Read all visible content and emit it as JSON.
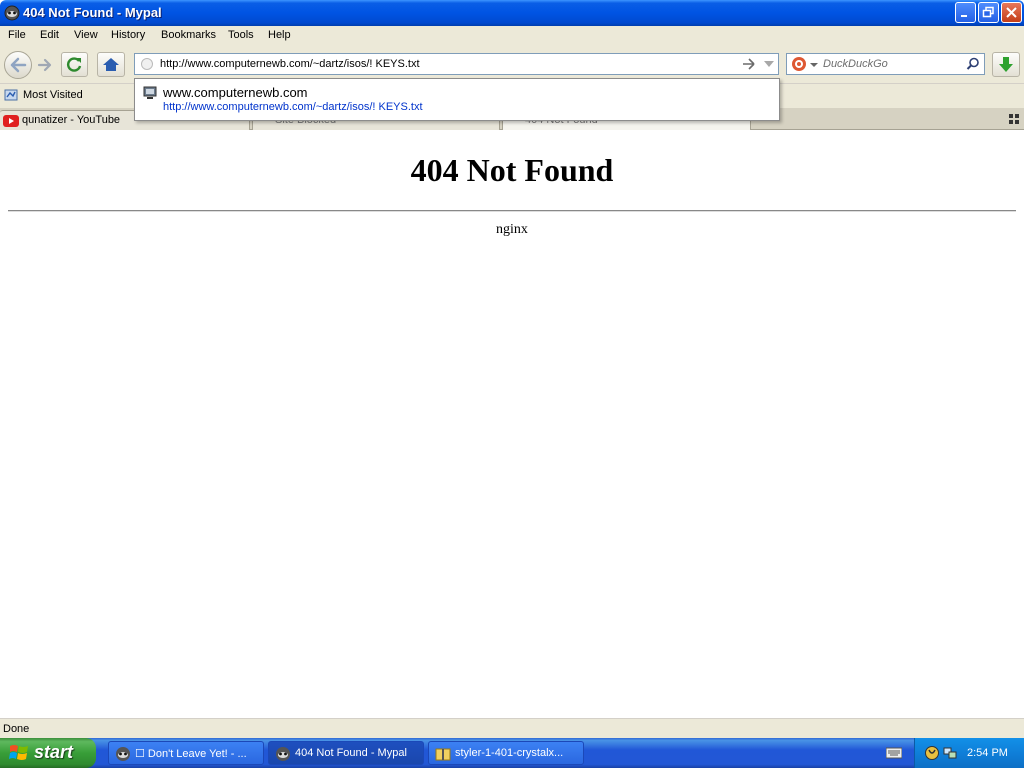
{
  "window": {
    "title": "404 Not Found - Mypal"
  },
  "menu": [
    "File",
    "Edit",
    "View",
    "History",
    "Bookmarks",
    "Tools",
    "Help"
  ],
  "navbar": {
    "url": "http://www.computernewb.com/~dartz/isos/! KEYS.txt",
    "search_placeholder": "DuckDuckGo"
  },
  "bookmarks": {
    "most_visited": "Most Visited"
  },
  "tabs": [
    {
      "label": "qunatizer - YouTube",
      "active": false
    },
    {
      "label": "Site Blocked",
      "active": false
    },
    {
      "label": "404 Not Found",
      "active": true
    }
  ],
  "autocomplete": {
    "title": "www.computernewb.com",
    "url": "http://www.computernewb.com/~dartz/isos/! KEYS.txt"
  },
  "page": {
    "heading": "404 Not Found",
    "server": "nginx"
  },
  "status": {
    "text": "Done"
  },
  "taskbar": {
    "start": "start",
    "items": [
      {
        "label": "☐ Don't Leave Yet! - ...",
        "active": false
      },
      {
        "label": "404 Not Found - Mypal",
        "active": true
      },
      {
        "label": "styler-1-401-crystalx...",
        "active": false
      }
    ],
    "clock": "2:54 PM"
  },
  "colors": {
    "titlebar": "#0054e3",
    "chrome": "#ece9d8",
    "taskbar": "#2257d5",
    "start": "#389e38",
    "link": "#0033cc"
  }
}
